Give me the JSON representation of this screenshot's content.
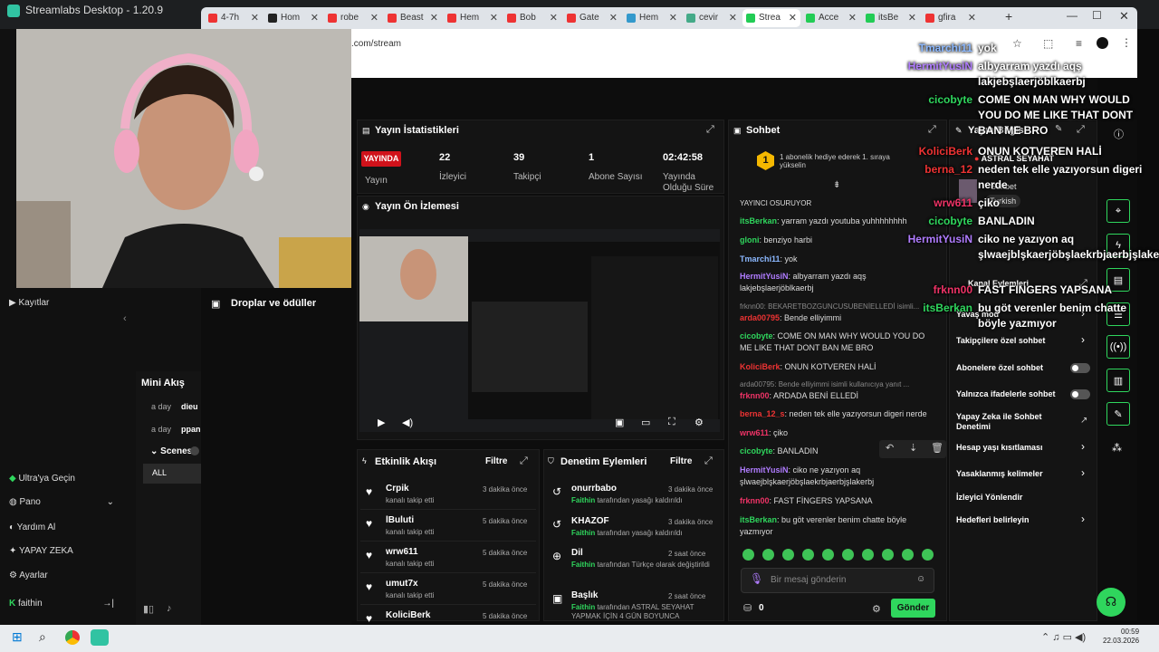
{
  "window": {
    "title": "Streamlabs Desktop - 1.20.9"
  },
  "browser": {
    "tabs": [
      {
        "label": "4-7h",
        "color": "#e33"
      },
      {
        "label": "Hom",
        "color": "#222"
      },
      {
        "label": "robe",
        "color": "#e33"
      },
      {
        "label": "Beast",
        "color": "#e33"
      },
      {
        "label": "Hem",
        "color": "#e33"
      },
      {
        "label": "Bob",
        "color": "#e33"
      },
      {
        "label": "Gate",
        "color": "#e33"
      },
      {
        "label": "Hem",
        "color": "#39c"
      },
      {
        "label": "cevir",
        "color": "#4a8"
      },
      {
        "label": "Strea",
        "color": "#2c5"
      },
      {
        "label": "Acce",
        "color": "#2c5"
      },
      {
        "label": "itsBe",
        "color": "#2c5"
      },
      {
        "label": "gfira",
        "color": "#e33"
      }
    ],
    "url": ".com/stream"
  },
  "stats": {
    "title": "Yayın İstatistikleri",
    "live": "YAYINDA",
    "live_label": "Yayın",
    "viewers": "22",
    "viewers_label": "İzleyici",
    "followers": "39",
    "followers_label": "Takipçi",
    "subs": "1",
    "subs_label": "Abone Sayısı",
    "uptime": "02:42:58",
    "uptime_label": "Yayında Olduğu Süre"
  },
  "preview": {
    "title": "Yayın Ön İzlemesi"
  },
  "drops": {
    "title": "Droplar ve ödüller"
  },
  "miniflow": {
    "title": "Mini Akış",
    "rows": [
      {
        "time": "a day",
        "text": "dieu"
      },
      {
        "time": "a day",
        "text": "ppan"
      }
    ]
  },
  "scenes": {
    "title": "Scenes",
    "item": "ALL"
  },
  "sidebar": {
    "items": [
      "Ultra'ya Geçin",
      "Pano",
      "Yardım Al",
      "YAPAY ZEKA",
      "Ayarlar"
    ],
    "recordings": "Kayıtlar",
    "user": "faithin"
  },
  "activity": {
    "title": "Etkinlik Akışı",
    "filter": "Filtre",
    "items": [
      {
        "name": "Crpik",
        "sub": "kanalı takip etti",
        "time": "3 dakika önce"
      },
      {
        "name": "lBuluti",
        "sub": "kanalı takip etti",
        "time": "5 dakika önce"
      },
      {
        "name": "wrw611",
        "sub": "kanalı takip etti",
        "time": "5 dakika önce"
      },
      {
        "name": "umut7x",
        "sub": "kanalı takip etti",
        "time": "5 dakika önce"
      },
      {
        "name": "KoliciBerk",
        "sub": "",
        "time": "5 dakika önce"
      }
    ]
  },
  "moderation": {
    "title": "Denetim Eylemleri",
    "filter": "Filtre",
    "items": [
      {
        "name": "onurrbabo",
        "by": "Faithin",
        "sub": " tarafından yasağı kaldırıldı",
        "time": "3 dakika önce"
      },
      {
        "name": "KHAZOF",
        "by": "Faithin",
        "sub": " tarafından yasağı kaldırıldı",
        "time": "3 dakika önce"
      },
      {
        "name": "Dil",
        "by": "Faithin",
        "sub": " tarafından Türkçe olarak değiştirildi",
        "time": "2 saat önce"
      },
      {
        "name": "Başlık",
        "by": "Faithin",
        "sub": " tarafından ASTRAL SEYAHAT YAPMAK İÇİN 4 GÜN BOYUNCA",
        "time": "2 saat önce"
      }
    ]
  },
  "chat": {
    "title": "Sohbet",
    "gift": "1 abonelik hediye ederek 1. sıraya yükselin",
    "placeholder": "Bir mesaj gönderin",
    "send": "Gönder",
    "count": "0",
    "messages": [
      {
        "user": "",
        "text": "YAYINCI OSURUYOR",
        "color": "#ddd"
      },
      {
        "user": "itsBerkan",
        "text": ": yarram yazdı youtuba yuhhhhhhhh",
        "color": "#2fd65d"
      },
      {
        "user": "gloni",
        "text": ": benziyo harbi",
        "color": "#2fd65d"
      },
      {
        "user": "Tmarchi11",
        "text": ": yok",
        "color": "#8bb8ff"
      },
      {
        "user": "HermitYusiN",
        "text": ": albyarram yazdı aqş lakjebşlaerjöblkaerbj",
        "color": "#b07cff"
      },
      {
        "user": "",
        "text": "frknn00: BEKARETBOZGUNCUSUBENİELLEDİ isimli...",
        "color": "#888"
      },
      {
        "user": "arda00795",
        "text": ": Bende elliyimmi",
        "color": "#e33"
      },
      {
        "user": "cicobyte",
        "text": ": COME ON MAN WHY WOULD YOU DO ME LIKE THAT DONT BAN ME BRO",
        "color": "#2fd65d"
      },
      {
        "user": "KoliciBerk",
        "text": ": ONUN KOTVEREN HALİ",
        "color": "#e33"
      },
      {
        "user": "",
        "text": "arda00795: Bende elliyimmi isimli kullanıcıya yanıt ...",
        "color": "#888"
      },
      {
        "user": "frknn00",
        "text": ": ARDADA BENİ ELLEDİ",
        "color": "#e36"
      },
      {
        "user": "berna_12_s",
        "text": ": neden tek elle yazıyorsun digeri nerde",
        "color": "#e33"
      },
      {
        "user": "wrw611",
        "text": ": çiko",
        "color": "#e36"
      },
      {
        "user": "cicobyte",
        "text": ": BANLADIN",
        "color": "#2fd65d"
      },
      {
        "user": "HermitYusiN",
        "text": ": ciko ne yazıyon aq şlwaejblşkaerjöbşlaekrbjaerbjşlakerbj",
        "color": "#b07cff"
      },
      {
        "user": "frknn00",
        "text": ": FAST FİNGERS YAPSANA",
        "color": "#e36"
      },
      {
        "user": "itsBerkan",
        "text": ": bu göt verenler benim chatte böyle yazmıyor",
        "color": "#2fd65d"
      }
    ]
  },
  "overlay": [
    {
      "user": "Tmarchi11",
      "text": "yok",
      "color": "#8bb8ff"
    },
    {
      "user": "HermitYusiN",
      "text": "albyarram yazdı aqş lakjebşlaerjöblkaerbj",
      "color": "#b07cff"
    },
    {
      "user": "cicobyte",
      "text": "COME ON MAN WHY WOULD YOU DO ME LIKE THAT DONT BAN ME BRO",
      "color": "#2fd65d"
    },
    {
      "user": "KoliciBerk",
      "text": "ONUN KOTVEREN HALİ",
      "color": "#e33"
    },
    {
      "user": "berna_12",
      "text": "neden tek elle yazıyorsun digeri nerde",
      "color": "#e33"
    },
    {
      "user": "wrw611",
      "text": "çiko",
      "color": "#e36"
    },
    {
      "user": "cicobyte",
      "text": "BANLADIN",
      "color": "#2fd65d"
    },
    {
      "user": "HermitYusiN",
      "text": "ciko ne yazıyon aq şlwaejblşkaerjöbşlaekrbjaerbjşlakerbj",
      "color": "#b07cff"
    },
    {
      "user": "frknn00",
      "text": "FAST FINGERS YAPSANA",
      "color": "#e36"
    },
    {
      "user": "itsBerkan",
      "text": "bu göt verenler benim chatte böyle yazmıyor",
      "color": "#2fd65d"
    }
  ],
  "stream_info": {
    "title": "Yayın Bilgisi",
    "game": "ASTRAL SEYAHAT",
    "lang_label": "Sohbet",
    "lang": "Turkish"
  },
  "channel": {
    "title": "Kanal Eylemleri",
    "settings": [
      "Yavaş mod",
      "Takipçilere özel sohbet",
      "Abonelere özel sohbet",
      "Yalnızca ifadelerle sohbet",
      "Yapay Zeka ile Sohbet Denetimi",
      "Hesap yaşı kısıtlaması",
      "Yasaklanmış kelimeler",
      "İzleyici Yönlendir",
      "Hedefleri belirleyin"
    ]
  },
  "taskbar": {
    "time": "00:59",
    "date": "22.03.2026"
  }
}
